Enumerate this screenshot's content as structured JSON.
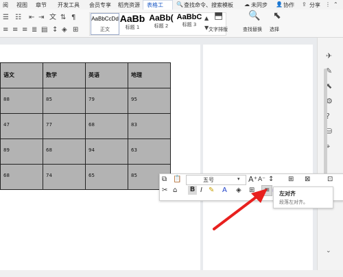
{
  "menu": {
    "items": [
      "阅",
      "视图",
      "章节",
      "开发工具",
      "会员专享",
      "稻壳资源",
      "表格工"
    ],
    "search_placeholder": "查找命令、搜索模板",
    "unsynced": "未同步",
    "collaborate": "协作",
    "share": "分享"
  },
  "ribbon": {
    "styles": [
      {
        "sample": "AaBbCcDd",
        "label": "正文"
      },
      {
        "sample": "AaBb",
        "label": "标题 1"
      },
      {
        "sample": "AaBb(",
        "label": "标题 2"
      },
      {
        "sample": "AaBbC",
        "label": "标题 3"
      }
    ],
    "text_layout": "文字排版",
    "find_replace": "查找替换",
    "select": "选择"
  },
  "table": {
    "headers": [
      "语文",
      "数学",
      "英语",
      "地理"
    ],
    "rows": [
      [
        "88",
        "85",
        "79",
        "95"
      ],
      [
        "47",
        "77",
        "68",
        "83"
      ],
      [
        "89",
        "68",
        "94",
        "63"
      ],
      [
        "68",
        "74",
        "65",
        "85"
      ]
    ]
  },
  "floatbar": {
    "font_size": "五号"
  },
  "tooltip": {
    "title": "左对齐",
    "desc": "段落左对齐。"
  }
}
